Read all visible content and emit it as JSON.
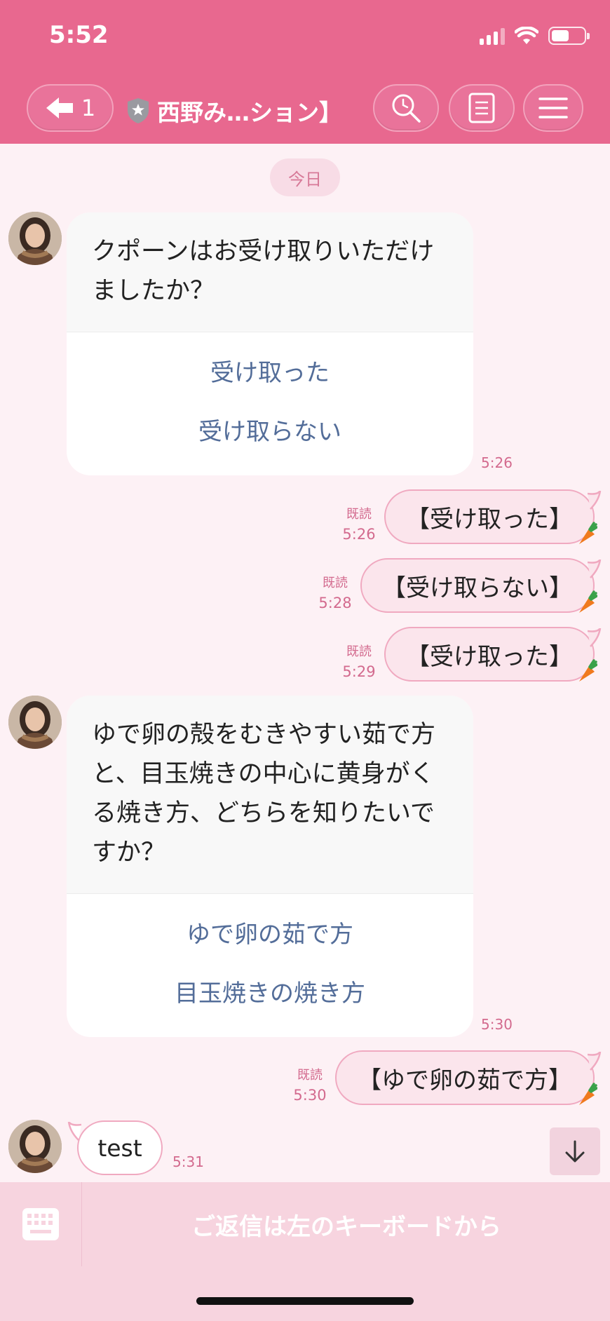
{
  "status_bar": {
    "time": "5:52"
  },
  "header": {
    "back_count": "1",
    "title": "西野み…ション】"
  },
  "date_label": "今日",
  "messages": [
    {
      "type": "question_card",
      "question": "クポーンはお受け取りいただけましたか？",
      "options": [
        "受け取った",
        "受け取らない"
      ],
      "time": "5:26"
    },
    {
      "type": "outgoing",
      "read": "既読",
      "time": "5:26",
      "text": "【受け取った】"
    },
    {
      "type": "outgoing",
      "read": "既読",
      "time": "5:28",
      "text": "【受け取らない】"
    },
    {
      "type": "outgoing",
      "read": "既読",
      "time": "5:29",
      "text": "【受け取った】"
    },
    {
      "type": "question_card",
      "question": "ゆで卵の殻をむきやすい茹で方と、目玉焼きの中心に黄身がくる焼き方、どちらを知りたいですか？",
      "options": [
        "ゆで卵の茹で方",
        "目玉焼きの焼き方"
      ],
      "time": "5:30"
    },
    {
      "type": "outgoing",
      "read": "既読",
      "time": "5:30",
      "text": "【ゆで卵の茹で方】"
    },
    {
      "type": "incoming",
      "text": "test",
      "time": "5:31"
    }
  ],
  "bottom_bar": {
    "hint": "ご返信は左のキーボードから"
  },
  "colors": {
    "header": "#e8688f",
    "background": "#fdf1f5",
    "bubble_border": "#f0a9c0",
    "option_text": "#536d99",
    "meta_text": "#d36a8e",
    "bottom_bar": "#f7d4df"
  }
}
